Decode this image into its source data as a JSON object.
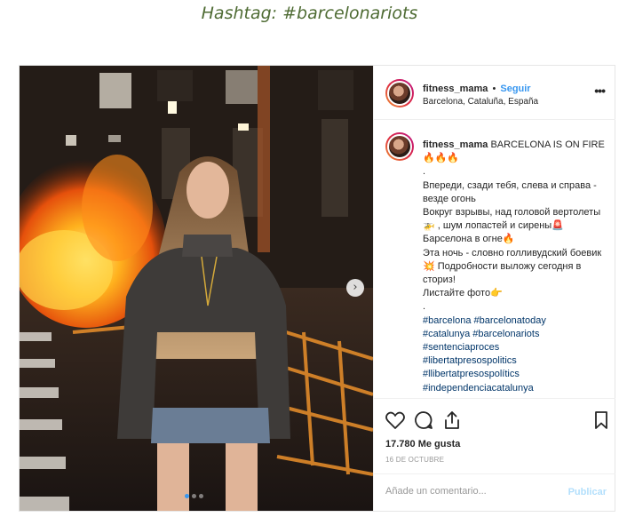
{
  "page": {
    "title": "Hashtag: #barcelonariots"
  },
  "post": {
    "username": "fitness_mama",
    "separator": "•",
    "follow_label": "Seguir",
    "location": "Barcelona, Cataluña, España",
    "more_icon": "more-horizontal-icon",
    "caption": {
      "lines": [
        "BARCELONA IS ON FIRE",
        "🔥🔥🔥",
        ".",
        "Впереди, сзади тебя, слева и справа - везде огонь",
        "Вокруг взрывы, над головой вертолеты🚁 , шум лопастей и сирены🚨 Барселона в огне🔥",
        "Эта ночь - словно голливудский боевик💥 Подробности выложу сегодня в сториз!",
        "Листайте фото👉",
        "."
      ],
      "hashtags": [
        "#barcelona #barcelonatoday",
        "#catalunya #barcelonariots",
        "#sentenciaproces",
        "#libertatpresospolitics",
        "#llibertatpresospolítics",
        "#independenciacatalunya"
      ]
    },
    "likes": "17.780 Me gusta",
    "date": "16 DE OCTUBRE",
    "comment_placeholder": "Añade un comentario...",
    "publish_label": "Publicar",
    "carousel": {
      "total": 3,
      "active": 1
    },
    "colors": {
      "accent": "#3897f0",
      "hashtag": "#003569",
      "title": "#4e6b33"
    }
  }
}
